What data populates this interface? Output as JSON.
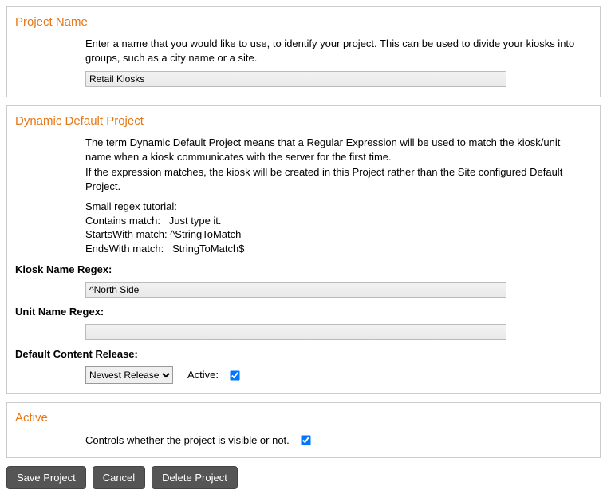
{
  "projectName": {
    "title": "Project Name",
    "desc": "Enter a name that you would like to use, to identify your project. This can be used to divide your kiosks into groups, such as a city name or a site.",
    "value": "Retail Kiosks"
  },
  "dynamic": {
    "title": "Dynamic Default Project",
    "desc1": "The term Dynamic Default Project means that a Regular Expression will be used to match the kiosk/unit name when a kiosk communicates with the server for the first time.",
    "desc2": "If the expression matches, the kiosk will be created in this Project rather than the Site configured Default Project.",
    "tutHeader": "Small regex tutorial:",
    "tut1": "Contains match:   Just type it.",
    "tut2": "StartsWith match: ^StringToMatch",
    "tut3": "EndsWith match:   StringToMatch$",
    "kioskRegexLabel": "Kiosk Name Regex:",
    "kioskRegexValue": "^North Side",
    "unitRegexLabel": "Unit Name Regex:",
    "unitRegexValue": "",
    "defaultReleaseLabel": "Default Content Release:",
    "releaseOptions": [
      "Newest Release"
    ],
    "releaseSelected": "Newest Release",
    "activeLabel": "Active:",
    "activeChecked": true
  },
  "activePanel": {
    "title": "Active",
    "desc": "Controls whether the project is visible or not.",
    "checked": true
  },
  "buttons": {
    "save": "Save Project",
    "cancel": "Cancel",
    "delete": "Delete Project"
  }
}
